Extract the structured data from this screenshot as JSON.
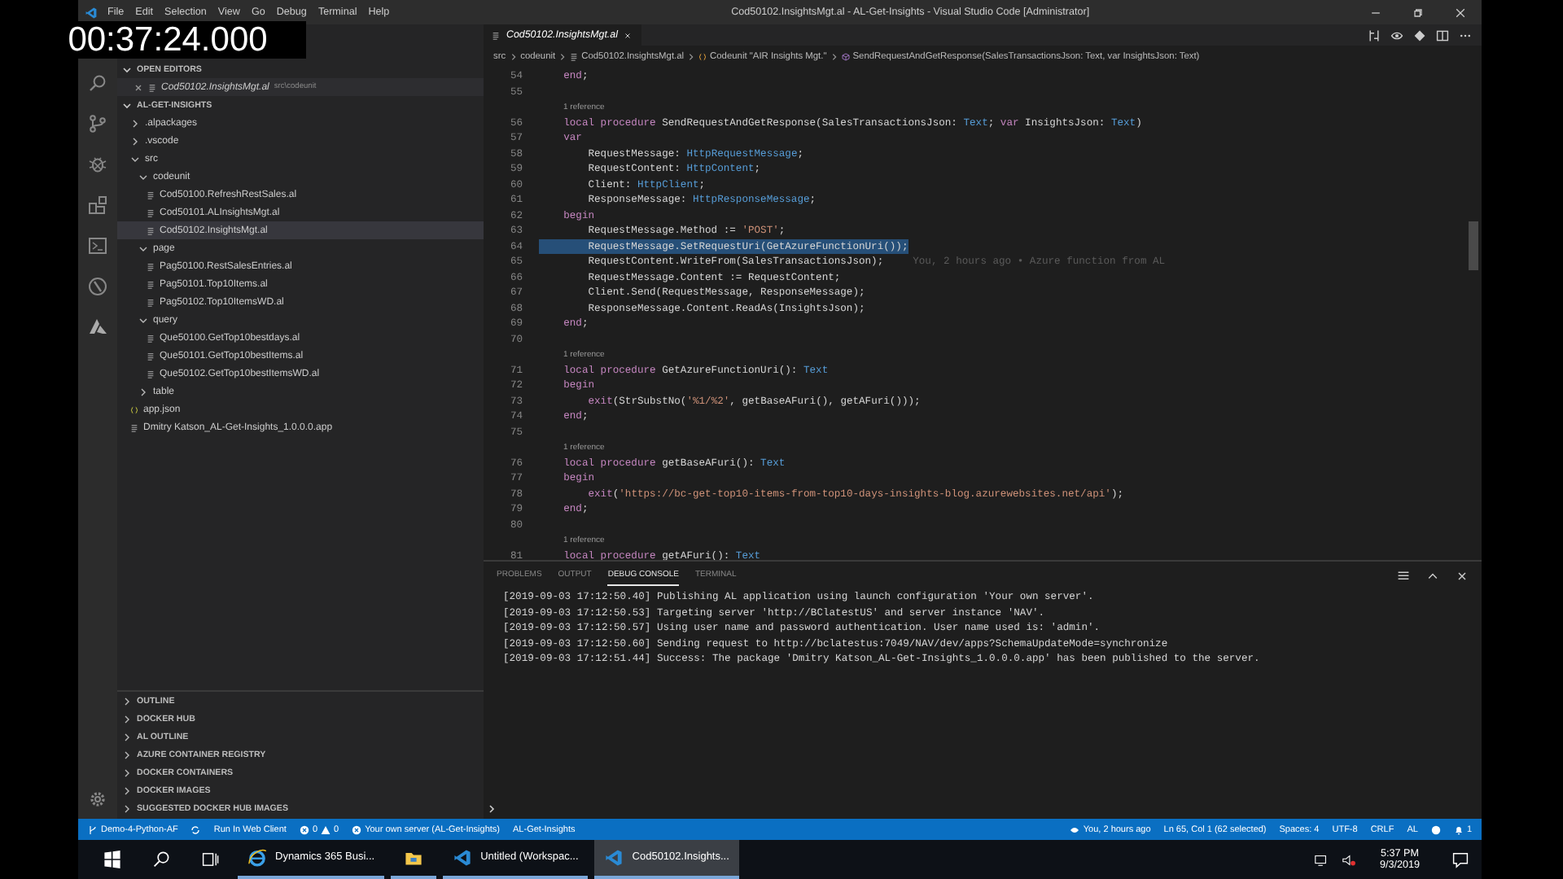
{
  "overlay": {
    "timestamp": "00:37:24.000"
  },
  "title_bar": {
    "menu": [
      "File",
      "Edit",
      "Selection",
      "View",
      "Go",
      "Debug",
      "Terminal",
      "Help"
    ],
    "title": "Cod50102.InsightsMgt.al - AL-Get-Insights - Visual Studio Code [Administrator]"
  },
  "sidebar": {
    "open_editors": {
      "title": "OPEN EDITORS",
      "items": [
        {
          "label": "Cod50102.InsightsMgt.al",
          "description": "src\\codeunit"
        }
      ]
    },
    "explorer": {
      "title": "AL-GET-INSIGHTS",
      "tree": [
        {
          "label": ".alpackages",
          "kind": "folder",
          "expanded": false,
          "selected": false
        },
        {
          "label": ".vscode",
          "kind": "folder",
          "expanded": false,
          "selected": false
        },
        {
          "label": "src",
          "kind": "folder",
          "expanded": true,
          "selected": false,
          "children": [
            {
              "label": "codeunit",
              "kind": "folder",
              "expanded": true,
              "selected": false,
              "children": [
                {
                  "label": "Cod50100.RefreshRestSales.al",
                  "kind": "file",
                  "selected": false
                },
                {
                  "label": "Cod50101.ALInsightsMgt.al",
                  "kind": "file",
                  "selected": false
                },
                {
                  "label": "Cod50102.InsightsMgt.al",
                  "kind": "file",
                  "selected": true
                }
              ]
            },
            {
              "label": "page",
              "kind": "folder",
              "expanded": true,
              "selected": false,
              "children": [
                {
                  "label": "Pag50100.RestSalesEntries.al",
                  "kind": "file",
                  "selected": false
                },
                {
                  "label": "Pag50101.Top10Items.al",
                  "kind": "file",
                  "selected": false
                },
                {
                  "label": "Pag50102.Top10ItemsWD.al",
                  "kind": "file",
                  "selected": false
                }
              ]
            },
            {
              "label": "query",
              "kind": "folder",
              "expanded": true,
              "selected": false,
              "children": [
                {
                  "label": "Que50100.GetTop10bestdays.al",
                  "kind": "file",
                  "selected": false
                },
                {
                  "label": "Que50101.GetTop10bestItems.al",
                  "kind": "file",
                  "selected": false
                },
                {
                  "label": "Que50102.GetTop10bestItemsWD.al",
                  "kind": "file",
                  "selected": false
                }
              ]
            },
            {
              "label": "table",
              "kind": "folder",
              "expanded": false,
              "selected": false
            }
          ]
        },
        {
          "label": "app.json",
          "kind": "json",
          "selected": false
        },
        {
          "label": "Dmitry Katson_AL-Get-Insights_1.0.0.0.app",
          "kind": "file",
          "selected": false
        }
      ]
    },
    "sections": [
      "OUTLINE",
      "DOCKER HUB",
      "AL OUTLINE",
      "AZURE CONTAINER REGISTRY",
      "DOCKER CONTAINERS",
      "DOCKER IMAGES",
      "SUGGESTED DOCKER HUB IMAGES"
    ]
  },
  "editor": {
    "tab": {
      "label": "Cod50102.InsightsMgt.al",
      "selected": true
    },
    "breadcrumbs": [
      {
        "label": "src",
        "kind": "folder"
      },
      {
        "label": "codeunit",
        "kind": "folder"
      },
      {
        "label": "Cod50102.InsightsMgt.al",
        "kind": "file"
      },
      {
        "label": "Codeunit \"AIR Insights Mgt.\"",
        "kind": "codeunit"
      },
      {
        "label": "SendRequestAndGetResponse(SalesTransactionsJson: Text, var InsightsJson: Text)",
        "kind": "method"
      }
    ],
    "lines": [
      {
        "kind": "code",
        "number": "54",
        "selected": false,
        "segments": [
          {
            "kind": "kw",
            "text": "    end"
          },
          {
            "kind": "plain",
            "text": ";"
          }
        ]
      },
      {
        "kind": "blank",
        "number": "55"
      },
      {
        "kind": "lens",
        "text": "1 reference"
      },
      {
        "kind": "code",
        "number": "56",
        "selected": false,
        "segments": [
          {
            "kind": "kw",
            "text": "    local procedure"
          },
          {
            "kind": "plain",
            "text": " SendRequestAndGetResponse(SalesTransactionsJson: "
          },
          {
            "kind": "type",
            "text": "Text"
          },
          {
            "kind": "plain",
            "text": "; "
          },
          {
            "kind": "kw",
            "text": "var"
          },
          {
            "kind": "plain",
            "text": " InsightsJson: "
          },
          {
            "kind": "type",
            "text": "Text"
          },
          {
            "kind": "plain",
            "text": ")"
          }
        ]
      },
      {
        "kind": "code",
        "number": "57",
        "selected": false,
        "segments": [
          {
            "kind": "kw",
            "text": "    var"
          }
        ]
      },
      {
        "kind": "code",
        "number": "58",
        "selected": false,
        "segments": [
          {
            "kind": "plain",
            "text": "        RequestMessage: "
          },
          {
            "kind": "type",
            "text": "HttpRequestMessage"
          },
          {
            "kind": "plain",
            "text": ";"
          }
        ]
      },
      {
        "kind": "code",
        "number": "59",
        "selected": false,
        "segments": [
          {
            "kind": "plain",
            "text": "        RequestContent: "
          },
          {
            "kind": "type",
            "text": "HttpContent"
          },
          {
            "kind": "plain",
            "text": ";"
          }
        ]
      },
      {
        "kind": "code",
        "number": "60",
        "selected": false,
        "segments": [
          {
            "kind": "plain",
            "text": "        Client: "
          },
          {
            "kind": "type",
            "text": "HttpClient"
          },
          {
            "kind": "plain",
            "text": ";"
          }
        ]
      },
      {
        "kind": "code",
        "number": "61",
        "selected": false,
        "segments": [
          {
            "kind": "plain",
            "text": "        ResponseMessage: "
          },
          {
            "kind": "type",
            "text": "HttpResponseMessage"
          },
          {
            "kind": "plain",
            "text": ";"
          }
        ]
      },
      {
        "kind": "code",
        "number": "62",
        "selected": false,
        "segments": [
          {
            "kind": "kw",
            "text": "    begin"
          }
        ]
      },
      {
        "kind": "code",
        "number": "63",
        "selected": false,
        "segments": [
          {
            "kind": "plain",
            "text": "        RequestMessage.Method := "
          },
          {
            "kind": "str",
            "text": "'POST'"
          },
          {
            "kind": "plain",
            "text": ";"
          }
        ]
      },
      {
        "kind": "code",
        "number": "64",
        "selected": true,
        "segments": [
          {
            "kind": "plain",
            "text": "        RequestMessage.SetRequestUri(GetAzureFunctionUri());"
          }
        ]
      },
      {
        "kind": "code",
        "number": "65",
        "selected": false,
        "annotation": "You, 2 hours ago • Azure function from AL",
        "segments": [
          {
            "kind": "plain",
            "text": "        RequestContent.WriteFrom(SalesTransactionsJson);"
          }
        ]
      },
      {
        "kind": "code",
        "number": "66",
        "selected": false,
        "segments": [
          {
            "kind": "plain",
            "text": "        RequestMessage.Content := RequestContent;"
          }
        ]
      },
      {
        "kind": "code",
        "number": "67",
        "selected": false,
        "segments": [
          {
            "kind": "plain",
            "text": "        Client.Send(RequestMessage, ResponseMessage);"
          }
        ]
      },
      {
        "kind": "code",
        "number": "68",
        "selected": false,
        "segments": [
          {
            "kind": "plain",
            "text": "        ResponseMessage.Content.ReadAs(InsightsJson);"
          }
        ]
      },
      {
        "kind": "code",
        "number": "69",
        "selected": false,
        "segments": [
          {
            "kind": "kw",
            "text": "    end"
          },
          {
            "kind": "plain",
            "text": ";"
          }
        ]
      },
      {
        "kind": "blank",
        "number": "70"
      },
      {
        "kind": "lens",
        "text": "1 reference"
      },
      {
        "kind": "code",
        "number": "71",
        "selected": false,
        "segments": [
          {
            "kind": "kw",
            "text": "    local procedure"
          },
          {
            "kind": "plain",
            "text": " GetAzureFunctionUri(): "
          },
          {
            "kind": "type",
            "text": "Text"
          }
        ]
      },
      {
        "kind": "code",
        "number": "72",
        "selected": false,
        "segments": [
          {
            "kind": "kw",
            "text": "    begin"
          }
        ]
      },
      {
        "kind": "code",
        "number": "73",
        "selected": false,
        "segments": [
          {
            "kind": "kw",
            "text": "        exit"
          },
          {
            "kind": "plain",
            "text": "(StrSubstNo("
          },
          {
            "kind": "str",
            "text": "'%1/%2'"
          },
          {
            "kind": "plain",
            "text": ", getBaseAFuri(), getAFuri()));"
          }
        ]
      },
      {
        "kind": "code",
        "number": "74",
        "selected": false,
        "segments": [
          {
            "kind": "kw",
            "text": "    end"
          },
          {
            "kind": "plain",
            "text": ";"
          }
        ]
      },
      {
        "kind": "blank",
        "number": "75"
      },
      {
        "kind": "lens",
        "text": "1 reference"
      },
      {
        "kind": "code",
        "number": "76",
        "selected": false,
        "segments": [
          {
            "kind": "kw",
            "text": "    local procedure"
          },
          {
            "kind": "plain",
            "text": " getBaseAFuri(): "
          },
          {
            "kind": "type",
            "text": "Text"
          }
        ]
      },
      {
        "kind": "code",
        "number": "77",
        "selected": false,
        "segments": [
          {
            "kind": "kw",
            "text": "    begin"
          }
        ]
      },
      {
        "kind": "code",
        "number": "78",
        "selected": false,
        "segments": [
          {
            "kind": "kw",
            "text": "        exit"
          },
          {
            "kind": "plain",
            "text": "("
          },
          {
            "kind": "str",
            "text": "'https://bc-get-top10-items-from-top10-days-insights-blog.azurewebsites.net/api'"
          },
          {
            "kind": "plain",
            "text": ");"
          }
        ]
      },
      {
        "kind": "code",
        "number": "79",
        "selected": false,
        "segments": [
          {
            "kind": "kw",
            "text": "    end"
          },
          {
            "kind": "plain",
            "text": ";"
          }
        ]
      },
      {
        "kind": "blank",
        "number": "80"
      },
      {
        "kind": "lens",
        "text": "1 reference"
      },
      {
        "kind": "code",
        "number": "81",
        "selected": false,
        "segments": [
          {
            "kind": "kw",
            "text": "    local procedure"
          },
          {
            "kind": "plain",
            "text": " getAFuri(): "
          },
          {
            "kind": "type",
            "text": "Text"
          }
        ]
      }
    ]
  },
  "panel": {
    "tabs": [
      {
        "label": "PROBLEMS",
        "selected": false
      },
      {
        "label": "OUTPUT",
        "selected": false
      },
      {
        "label": "DEBUG CONSOLE",
        "selected": true
      },
      {
        "label": "TERMINAL",
        "selected": false
      }
    ],
    "lines": [
      "[2019-09-03 17:12:50.40] Publishing AL application using launch configuration 'Your own server'.",
      "[2019-09-03 17:12:50.53] Targeting server 'http://BClatestUS' and server instance 'NAV'.",
      "[2019-09-03 17:12:50.57] Using user name and password authentication. User name used is: 'admin'.",
      "[2019-09-03 17:12:50.60] Sending request to http://bclatestus:7049/NAV/dev/apps?SchemaUpdateMode=synchronize",
      "[2019-09-03 17:12:51.44] Success: The package 'Dmitry Katson_AL-Get-Insights_1.0.0.0.app' has been published to the server."
    ]
  },
  "status_bar": {
    "left": [
      {
        "kind": "branch",
        "text": "Demo-4-Python-AF"
      },
      {
        "kind": "sync"
      },
      {
        "kind": "text",
        "text": "Run In Web Client"
      },
      {
        "kind": "problems",
        "errors": "0",
        "warnings": "0"
      },
      {
        "kind": "server",
        "text": "Your own server (AL-Get-Insights)"
      },
      {
        "kind": "text",
        "text": "AL-Get-Insights"
      }
    ],
    "right": [
      {
        "kind": "blame",
        "text": "You, 2 hours ago"
      },
      {
        "kind": "text",
        "text": "Ln 65, Col 1 (62 selected)"
      },
      {
        "kind": "text",
        "text": "Spaces: 4"
      },
      {
        "kind": "text",
        "text": "UTF-8"
      },
      {
        "kind": "text",
        "text": "CRLF"
      },
      {
        "kind": "text",
        "text": "AL"
      },
      {
        "kind": "feedback"
      },
      {
        "kind": "bell",
        "text": "1"
      }
    ]
  },
  "taskbar": {
    "apps": [
      {
        "kind": "ie",
        "label": "Dynamics 365 Busi...",
        "selected": false
      },
      {
        "kind": "files",
        "selected": false
      },
      {
        "kind": "vscode",
        "label": "Untitled (Workspac...",
        "selected": false
      },
      {
        "kind": "vscode",
        "label": "Cod50102.Insights...",
        "selected": true
      }
    ],
    "time": "5:37 PM",
    "date": "9/3/2019"
  }
}
